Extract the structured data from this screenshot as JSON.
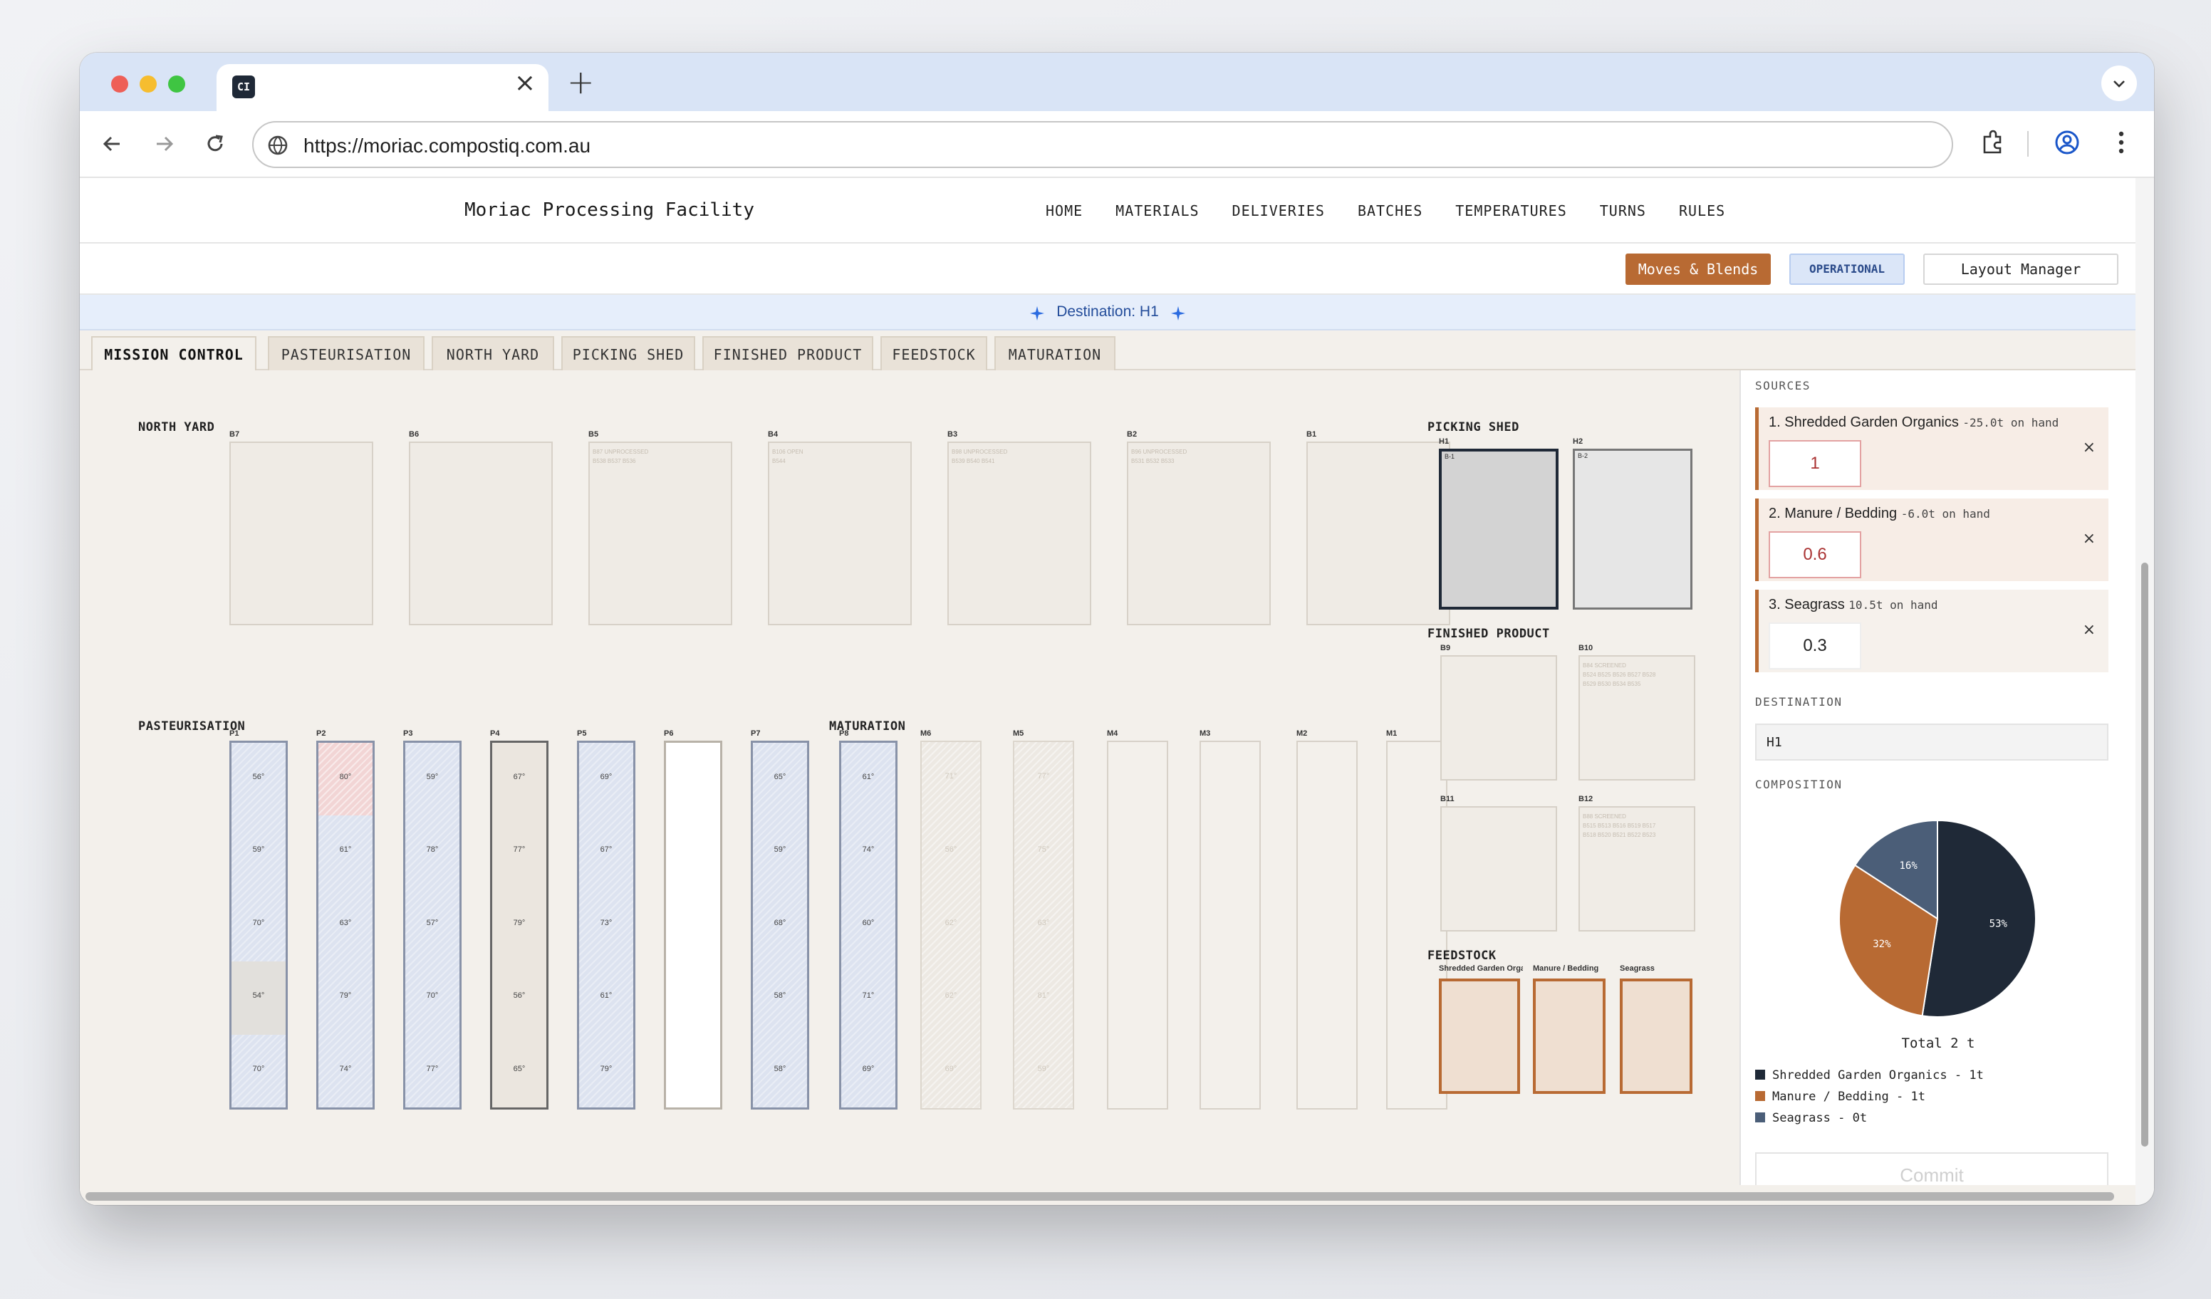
{
  "browser": {
    "tab_favicon": "CI",
    "url": "https://moriac.compostiq.com.au"
  },
  "site": {
    "brand": "Moriac Processing Facility",
    "nav": [
      "HOME",
      "MATERIALS",
      "DELIVERIES",
      "BATCHES",
      "TEMPERATURES",
      "TURNS",
      "RULES"
    ]
  },
  "actions": {
    "moves": "Moves & Blends",
    "status": "OPERATIONAL",
    "layout": "Layout Manager"
  },
  "destination_banner": "Destination: H1",
  "tabs": [
    "MISSION CONTROL",
    "PASTEURISATION",
    "NORTH YARD",
    "PICKING SHED",
    "FINISHED PRODUCT",
    "FEEDSTOCK",
    "MATURATION"
  ],
  "north_yard": {
    "title": "NORTH YARD",
    "bays": [
      {
        "name": "B7",
        "note": ""
      },
      {
        "name": "B6",
        "note": ""
      },
      {
        "name": "B5",
        "note": "B87 UNPROCESSED\nB538 B537 B536"
      },
      {
        "name": "B4",
        "note": "B106 OPEN\nB544"
      },
      {
        "name": "B3",
        "note": "B98 UNPROCESSED\nB539 B540 B541"
      },
      {
        "name": "B2",
        "note": "B96 UNPROCESSED\nB531 B532 B533"
      },
      {
        "name": "B1",
        "note": ""
      }
    ]
  },
  "pasteurisation": {
    "title": "PASTEURISATION",
    "piles": [
      {
        "name": "P1",
        "temps": [
          "56°",
          "59°",
          "70°",
          "54°",
          "70°"
        ]
      },
      {
        "name": "P2",
        "temps": [
          "80°",
          "61°",
          "63°",
          "79°",
          "74°"
        ]
      },
      {
        "name": "P3",
        "temps": [
          "59°",
          "78°",
          "57°",
          "70°",
          "77°"
        ]
      },
      {
        "name": "P4",
        "temps": [
          "67°",
          "77°",
          "79°",
          "56°",
          "65°"
        ]
      },
      {
        "name": "P5",
        "temps": [
          "69°",
          "67°",
          "73°",
          "61°",
          "79°"
        ]
      },
      {
        "name": "P6",
        "temps": []
      },
      {
        "name": "P7",
        "temps": [
          "65°",
          "59°",
          "68°",
          "58°",
          "58°"
        ]
      },
      {
        "name": "P8",
        "temps": [
          "61°",
          "74°",
          "60°",
          "71°",
          "69°"
        ]
      }
    ]
  },
  "maturation": {
    "title": "MATURATION",
    "piles": [
      {
        "name": "M6",
        "temps": [
          "71°",
          "56°",
          "62°",
          "62°",
          "69°"
        ]
      },
      {
        "name": "M5",
        "temps": [
          "77°",
          "75°",
          "63°",
          "81°",
          "59°"
        ]
      },
      {
        "name": "M4",
        "temps": []
      },
      {
        "name": "M3",
        "temps": []
      },
      {
        "name": "M2",
        "temps": []
      },
      {
        "name": "M1",
        "temps": []
      }
    ]
  },
  "picking_shed": {
    "title": "PICKING SHED",
    "bays": [
      {
        "name": "H1",
        "tag": "B-1"
      },
      {
        "name": "H2",
        "tag": "B-2"
      }
    ]
  },
  "finished_product": {
    "title": "FINISHED PRODUCT",
    "bays": [
      {
        "name": "B9",
        "note": ""
      },
      {
        "name": "B10",
        "note": "B84 SCREENED\nB524 B525 B526 B527 B528\nB529 B530 B534 B535"
      },
      {
        "name": "B11",
        "note": ""
      },
      {
        "name": "B12",
        "note": "B88 SCREENED\nB515 B513 B516 B519 B517\nB518 B520 B521 B522 B523"
      }
    ]
  },
  "feedstock": {
    "title": "FEEDSTOCK",
    "bins": [
      "Shredded Garden Organics",
      "Manure / Bedding",
      "Seagrass"
    ]
  },
  "panel": {
    "sources_label": "SOURCES",
    "sources": [
      {
        "name": "1. Shredded Garden Organics",
        "onhand": "-25.0t on hand",
        "value": "1"
      },
      {
        "name": "2. Manure / Bedding",
        "onhand": "-6.0t on hand",
        "value": "0.6"
      },
      {
        "name": "3. Seagrass",
        "onhand": "10.5t on hand",
        "value": "0.3"
      }
    ],
    "destination_label": "DESTINATION",
    "destination_value": "H1",
    "composition_label": "COMPOSITION",
    "total": "Total 2 t",
    "legend": [
      "Shredded Garden Organics - 1t",
      "Manure / Bedding - 1t",
      "Seagrass - 0t"
    ],
    "commit": "Commit"
  },
  "chart_data": {
    "type": "pie",
    "categories": [
      "Shredded Garden Organics",
      "Manure / Bedding",
      "Seagrass"
    ],
    "values": [
      53,
      32,
      16
    ],
    "labels": [
      "53%",
      "32%",
      "16%"
    ],
    "colors": [
      "#1f2937",
      "#b86a33",
      "#4b5e78"
    ]
  }
}
